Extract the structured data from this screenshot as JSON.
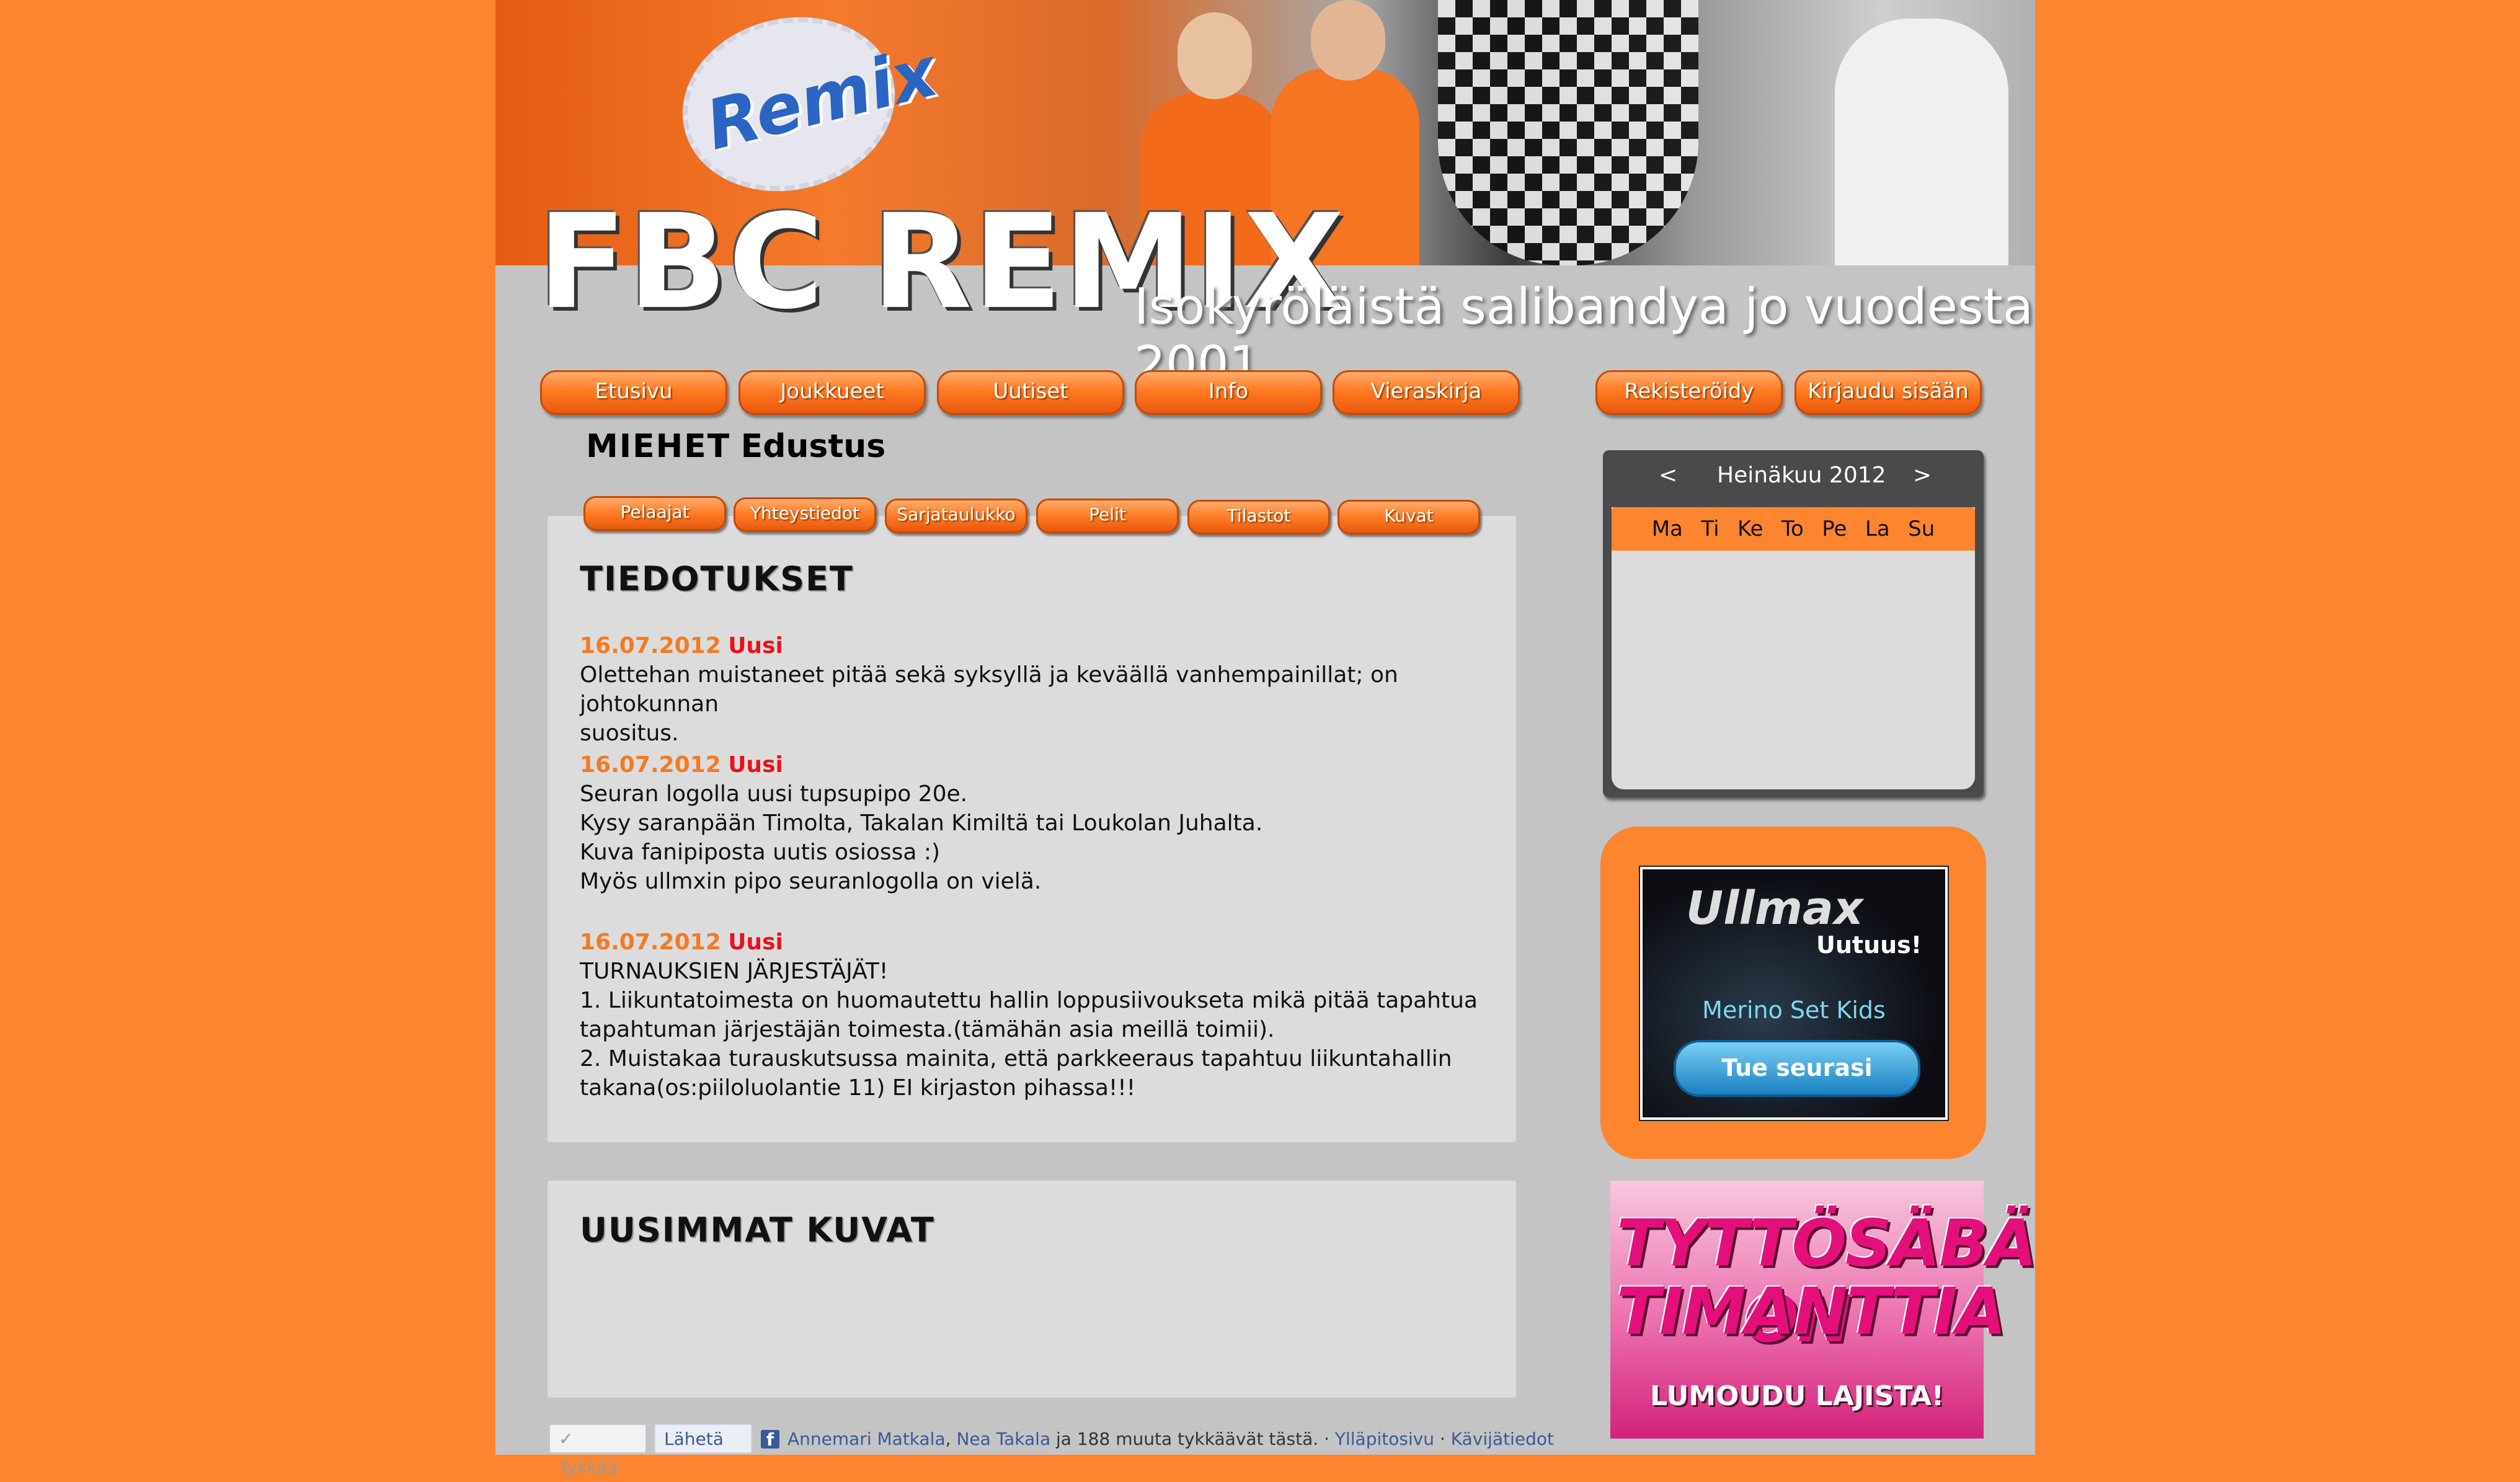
{
  "header": {
    "logo_badge_text": "Remix",
    "brand_title": "FBC REMIX",
    "tagline": "Isokyröläistä salibandya jo vuodesta 2001"
  },
  "nav": {
    "items": [
      "Etusivu",
      "Joukkueet",
      "Uutiset",
      "Info",
      "Vieraskirja"
    ],
    "register": "Rekisteröidy",
    "login": "Kirjaudu sisään"
  },
  "team": {
    "name": "MIEHET",
    "subtitle": "Edustus",
    "tabs": [
      "Pelaajat",
      "Yhteystiedot",
      "Sarjataulukko",
      "Pelit",
      "Tilastot",
      "Kuvat"
    ]
  },
  "announcements": {
    "title": "TIEDOTUKSET",
    "items": [
      {
        "date": "16.07.2012",
        "badge": "Uusi",
        "lines": [
          "Olettehan muistaneet pitää sekä syksyllä ja keväällä vanhempainillat; on johtokunnan",
          "suositus."
        ]
      },
      {
        "date": "16.07.2012",
        "badge": "Uusi",
        "lines": [
          "Seuran logolla uusi tupsupipo 20e.",
          "Kysy saranpään Timolta, Takalan Kimiltä tai Loukolan Juhalta.",
          "Kuva fanipiposta uutis osiossa :)",
          "Myös ullmxin pipo seuranlogolla on vielä."
        ]
      },
      {
        "date": "16.07.2012",
        "badge": "Uusi",
        "lines": [
          "TURNAUKSIEN JÄRJESTÄJÄT!",
          "1. Liikuntatoimesta on huomautettu hallin loppusiivoukseta mikä pitää tapahtua",
          "tapahtuman järjestäjän toimesta.(tämähän asia meillä toimii).",
          "2. Muistakaa turauskutsussa mainita, että parkkeeraus tapahtuu liikuntahallin",
          "takana(os:piiloluolantie 11) EI kirjaston pihassa!!!"
        ]
      }
    ]
  },
  "photos": {
    "title": "UUSIMMAT KUVAT"
  },
  "calendar": {
    "prev": "<",
    "month": "Heinäkuu 2012",
    "next": ">",
    "days": [
      "Ma",
      "Ti",
      "Ke",
      "To",
      "Pe",
      "La",
      "Su"
    ]
  },
  "ads": {
    "ullmax_brand": "Ullmax",
    "ullmax_new": "Uutuus!",
    "ullmax_product": "Merino Set Kids",
    "ullmax_button": "Tue seurasi",
    "girls_line1": "TYTTÖSÄBÄ ON",
    "girls_line2": "TIMANTTIA",
    "girls_line3": "LUMOUDU LAJISTA!"
  },
  "facebook": {
    "like": "✓ Tykkää",
    "send": "Lähetä",
    "logo": "f",
    "friend1": "Annemari Matkala",
    "sep1": ", ",
    "friend2": "Nea Takala",
    "rest": " ja 188 muuta tykkäävät tästä.",
    "dot1": " · ",
    "admin": "Ylläpitosivu",
    "dot2": " · ",
    "userinfo": "Kävijätiedot"
  }
}
